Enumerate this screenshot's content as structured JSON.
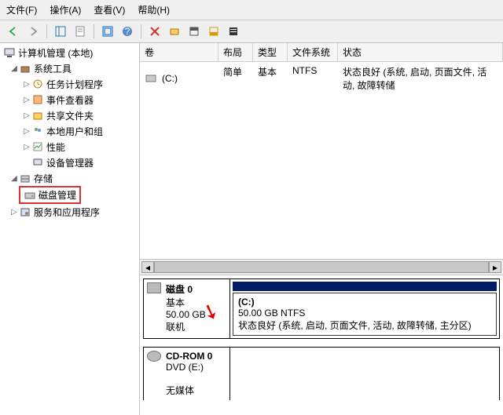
{
  "menu": {
    "file": "文件(F)",
    "action": "操作(A)",
    "view": "查看(V)",
    "help": "帮助(H)"
  },
  "tree": {
    "root": "计算机管理 (本地)",
    "sys_tools": "系统工具",
    "task_sched": "任务计划程序",
    "event_viewer": "事件查看器",
    "shared_folders": "共享文件夹",
    "local_users": "本地用户和组",
    "performance": "性能",
    "device_mgr": "设备管理器",
    "storage": "存储",
    "disk_mgmt": "磁盘管理",
    "services": "服务和应用程序"
  },
  "table": {
    "h_vol": "卷",
    "h_layout": "布局",
    "h_type": "类型",
    "h_fs": "文件系统",
    "h_status": "状态",
    "rows": [
      {
        "vol": "(C:)",
        "layout": "简单",
        "type": "基本",
        "fs": "NTFS",
        "status": "状态良好 (系统, 启动, 页面文件, 活动, 故障转储"
      }
    ]
  },
  "disks": [
    {
      "name": "磁盘 0",
      "type": "基本",
      "size": "50.00 GB",
      "status": "联机",
      "partition": {
        "label": "(C:)",
        "info": "50.00 GB NTFS",
        "status": "状态良好 (系统, 启动, 页面文件, 活动, 故障转储, 主分区)"
      }
    },
    {
      "name": "CD-ROM 0",
      "type": "DVD (E:)",
      "size": "",
      "status": "无媒体"
    }
  ]
}
